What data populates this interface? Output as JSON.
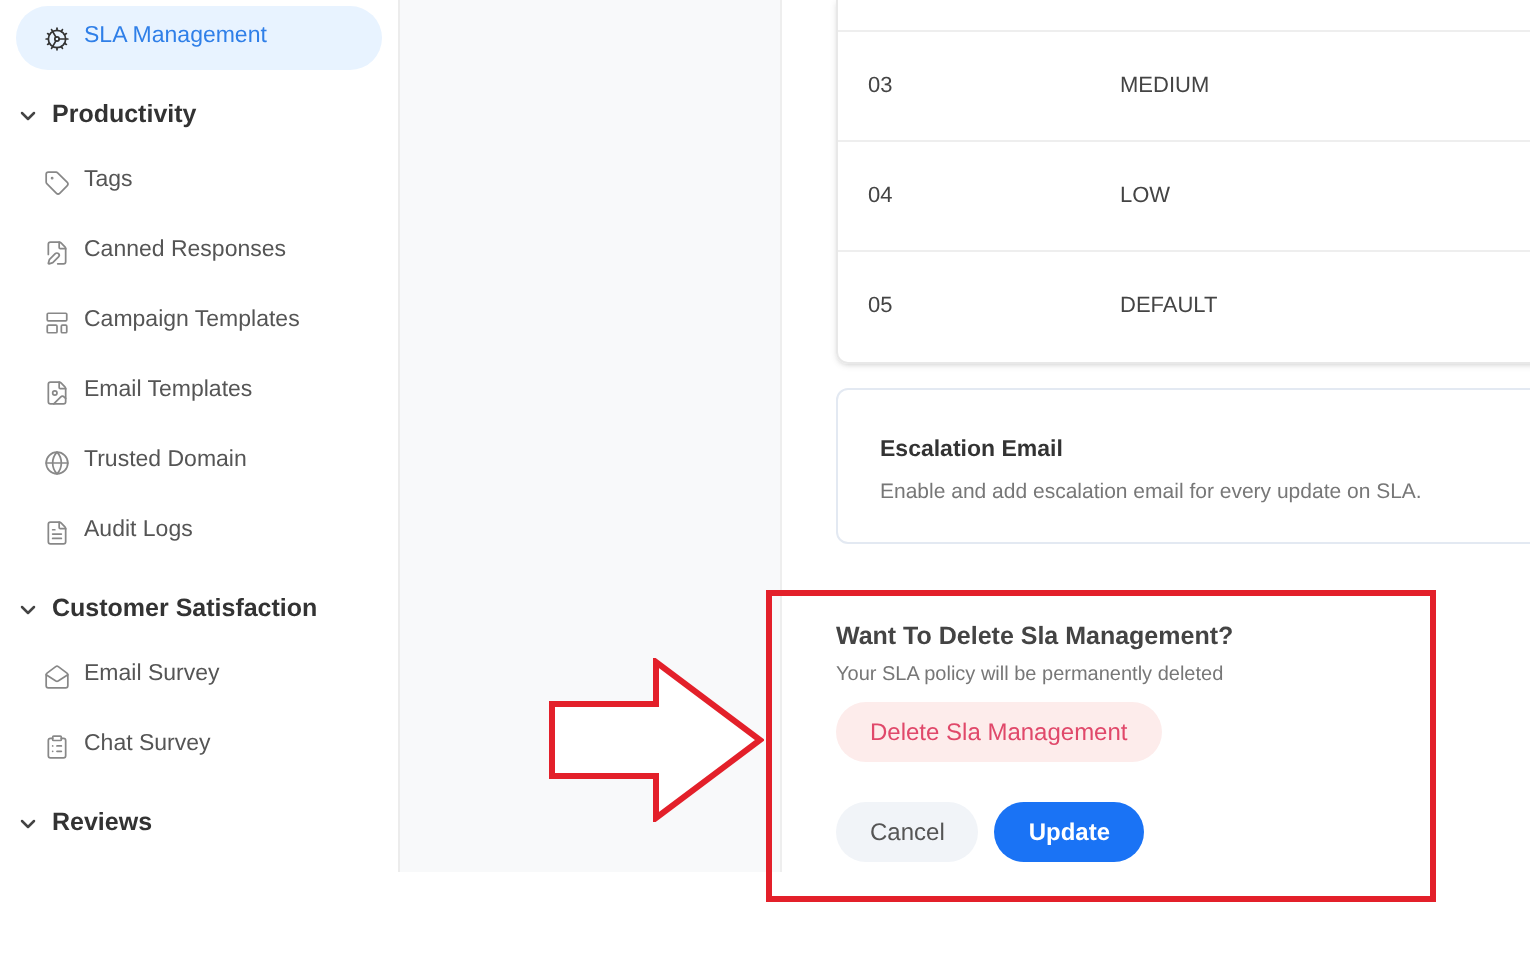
{
  "sidebar": {
    "items": [
      {
        "kind": "item",
        "label": "SLA Management",
        "selected": true
      },
      {
        "kind": "header",
        "label": "Productivity",
        "expanded": true
      },
      {
        "kind": "item",
        "label": "Tags",
        "selected": false
      },
      {
        "kind": "item",
        "label": "Canned Responses",
        "selected": false
      },
      {
        "kind": "item",
        "label": "Campaign Templates",
        "selected": false
      },
      {
        "kind": "item",
        "label": "Email Templates",
        "selected": false
      },
      {
        "kind": "item",
        "label": "Trusted Domain",
        "selected": false
      },
      {
        "kind": "item",
        "label": "Audit Logs",
        "selected": false
      },
      {
        "kind": "header",
        "label": "Customer Satisfaction",
        "expanded": true
      },
      {
        "kind": "item",
        "label": "Email Survey",
        "selected": false
      },
      {
        "kind": "item",
        "label": "Chat Survey",
        "selected": false
      },
      {
        "kind": "header",
        "label": "Reviews",
        "expanded": true
      }
    ]
  },
  "priority_table": {
    "rows": [
      {
        "number": "03",
        "priority": "MEDIUM"
      },
      {
        "number": "04",
        "priority": "LOW"
      },
      {
        "number": "05",
        "priority": "DEFAULT"
      }
    ]
  },
  "escalation": {
    "title": "Escalation Email",
    "description": "Enable and add escalation email for every update on SLA."
  },
  "delete_section": {
    "title": "Want To Delete Sla Management?",
    "description": "Your SLA policy will be permanently deleted",
    "delete_button": "Delete Sla Management"
  },
  "buttons": [
    {
      "kind": "secondary",
      "label": "Cancel"
    },
    {
      "kind": "primary",
      "label": "Update"
    }
  ]
}
